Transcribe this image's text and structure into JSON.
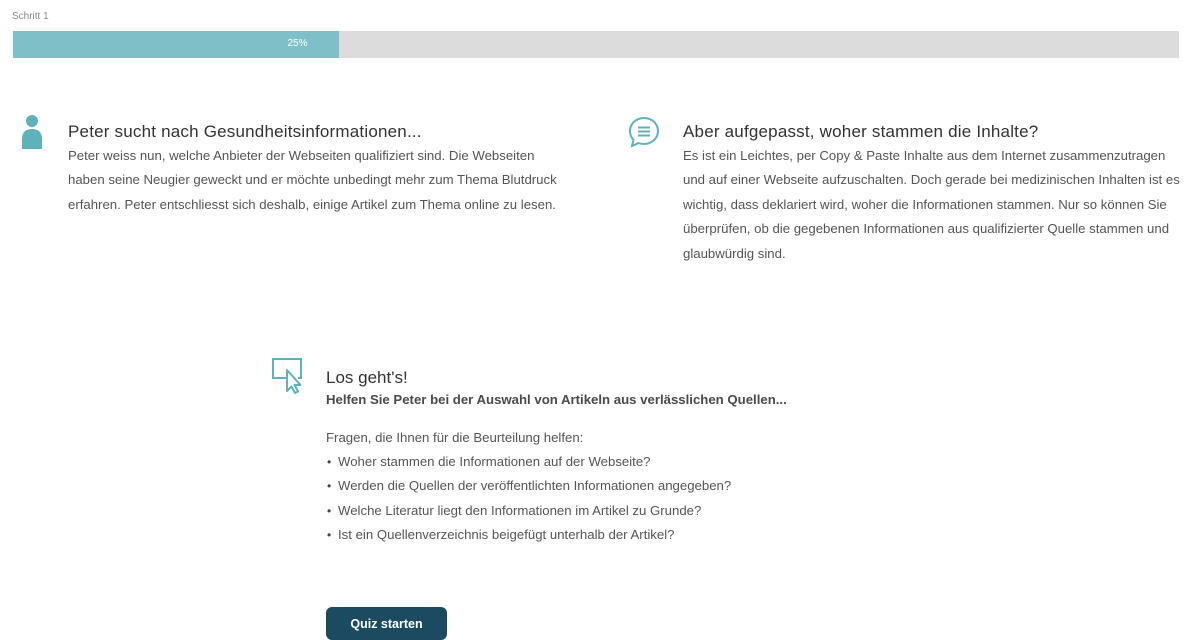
{
  "progress": {
    "step_label": "Schritt 1",
    "percent_text": "25%",
    "value": 0.28,
    "fill_color": "#7fc0c8"
  },
  "blocks": [
    {
      "icon": "person-icon",
      "title": "Peter sucht nach Gesundheitsinformationen...",
      "body": "Peter weiss nun, welche Anbieter der Webseiten qualifiziert sind. Die Webseiten haben seine Neugier geweckt und er möchte unbedingt mehr zum Thema Blutdruck erfahren. Peter entschliesst sich deshalb, einige Artikel zum Thema online zu lesen."
    },
    {
      "icon": "chat-bubble-icon",
      "title": "Aber aufgepasst, woher stammen die Inhalte?",
      "body": "Es ist ein Leichtes, per Copy & Paste Inhalte aus dem Internet zusammenzutragen und auf einer Webseite aufzuschalten. Doch gerade bei medizinischen Inhalten ist es wichtig, dass deklariert wird, woher die Informationen stammen. Nur so können Sie überprüfen, ob die gegebenen Informationen aus qualifizierter Quelle stammen und glaubwürdig sind."
    }
  ],
  "start": {
    "icon": "pointer-click-icon",
    "title": "Los geht's!",
    "subtitle": "Helfen Sie Peter bei der Auswahl von Artikeln aus verlässlichen Quellen...",
    "questions_intro": "Fragen, die Ihnen für die Beurteilung helfen:",
    "questions": [
      "Woher stammen die Informationen auf der Webseite?",
      "Werden die Quellen der veröffentlichten Informationen angegeben?",
      "Welche Literatur liegt den Informationen im Artikel zu Grunde?",
      "Ist ein Quellenverzeichnis beigefügt unterhalb der Artikel?"
    ],
    "button_label": "Quiz starten"
  },
  "colors": {
    "accent": "#5fb2bb",
    "button": "#1b4a61",
    "track": "#dcdcdc"
  }
}
